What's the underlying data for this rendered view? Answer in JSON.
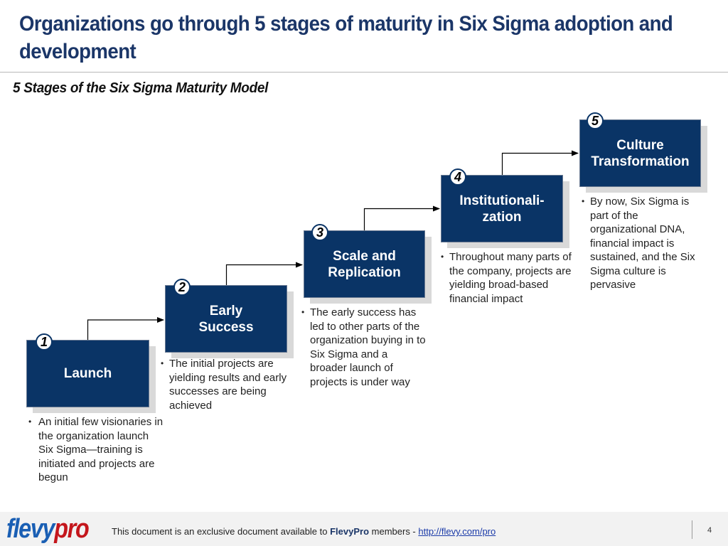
{
  "header": {
    "title": "Organizations go through 5 stages of maturity in Six Sigma adoption and development",
    "subtitle": "5 Stages of the Six Sigma Maturity Model"
  },
  "stages": [
    {
      "number": "1",
      "label": "Launch",
      "description": "An initial few visionaries in the organization launch Six Sigma—training is initiated and projects are begun"
    },
    {
      "number": "2",
      "label": "Early Success",
      "description": "The initial projects are yielding results and early successes are being achieved"
    },
    {
      "number": "3",
      "label": "Scale and Replication",
      "description": "The early success has led to other parts of the organization buying in to Six Sigma and a broader launch of projects is under way"
    },
    {
      "number": "4",
      "label": "Institutionali-zation",
      "description": "Throughout many parts of the company, projects are yielding broad-based financial impact"
    },
    {
      "number": "5",
      "label": "Culture Transformation",
      "description": "By now, Six Sigma is part of the organizational DNA, financial impact is sustained, and the Six Sigma culture is pervasive"
    }
  ],
  "bullet_glyph": "•",
  "colors": {
    "title": "#1b3668",
    "box_fill": "#0a3466",
    "shadow": "#d9d9d9",
    "logo_blue": "#1a5fb4",
    "logo_red": "#c4161c"
  },
  "footer": {
    "logo_part1": "flevy",
    "logo_part2": "pro",
    "note_prefix": "This document is an exclusive document available to ",
    "note_brand": "FlevyPro",
    "note_middle": " members - ",
    "note_link": "http://flevy.com/pro",
    "page_number": "4"
  }
}
